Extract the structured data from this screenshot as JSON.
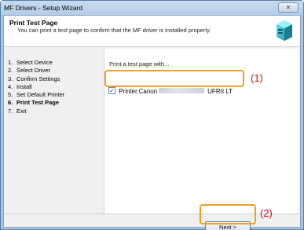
{
  "window": {
    "title": "MF Drivers - Setup Wizard",
    "close_glyph": "⨯"
  },
  "header": {
    "title": "Print Test Page",
    "description": "You can print a test page to confirm that the MF driver is installed properly."
  },
  "steps": [
    {
      "num": "1.",
      "label": "Select Device",
      "active": false
    },
    {
      "num": "2.",
      "label": "Select Driver",
      "active": false
    },
    {
      "num": "3.",
      "label": "Confirm Settings",
      "active": false
    },
    {
      "num": "4.",
      "label": "Install",
      "active": false
    },
    {
      "num": "5.",
      "label": "Set Default Printer",
      "active": false
    },
    {
      "num": "6.",
      "label": "Print Test Page",
      "active": true
    },
    {
      "num": "7.",
      "label": "Exit",
      "active": false
    }
  ],
  "content": {
    "prompt": "Print a test page with...",
    "printer_prefix": "Printer.Canon",
    "printer_suffix": "UFRII LT",
    "checked": true,
    "check_glyph": "✓"
  },
  "callouts": {
    "one": "(1)",
    "two": "(2)"
  },
  "buttons": {
    "next": "Next >"
  },
  "colors": {
    "highlight": "#f0a020",
    "callout": "#d30b0b",
    "titlebar": "#b3cde6"
  }
}
